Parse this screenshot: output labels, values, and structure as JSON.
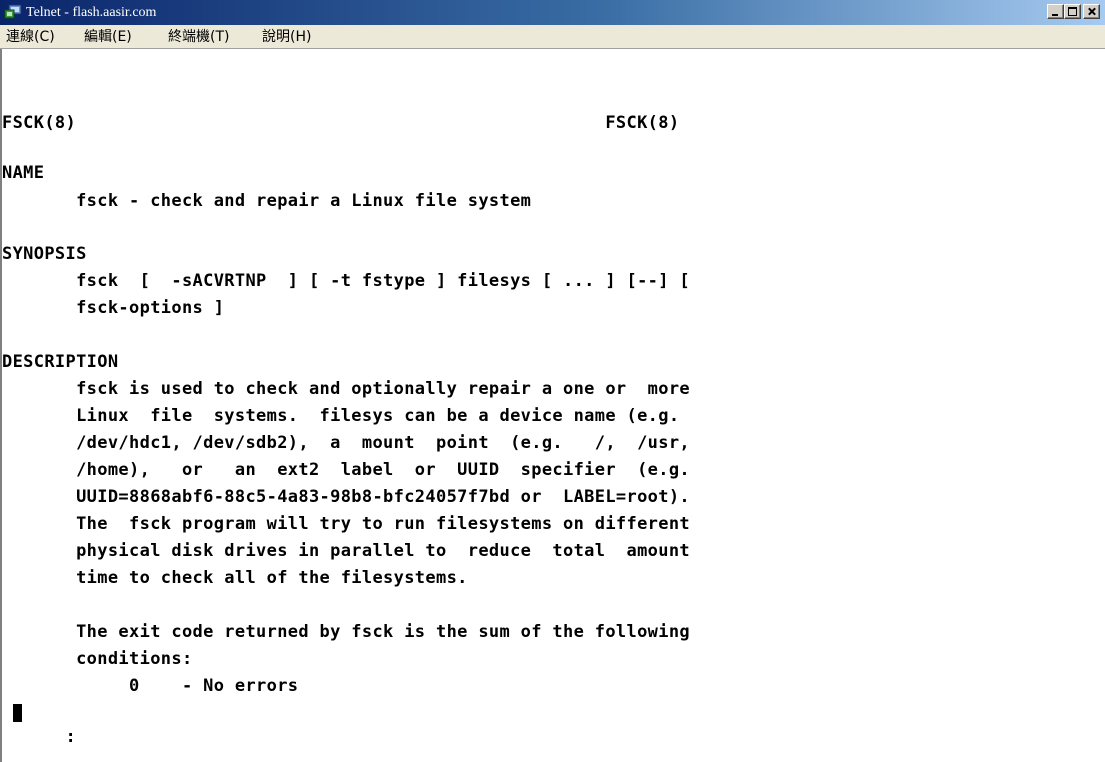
{
  "window": {
    "title": "Telnet - flash.aasir.com",
    "controls": {
      "minimize_icon": "minimize-icon",
      "maximize_icon": "maximize-icon",
      "close_icon": "close-icon"
    }
  },
  "menu": {
    "items": [
      "連線(C)",
      "編輯(E)",
      "終端機(T)",
      "說明(H)"
    ]
  },
  "terminal": {
    "lines": [
      "",
      "FSCK(8)                                                  FSCK(8)",
      "",
      "NAME",
      "       fsck - check and repair a Linux file system",
      "",
      "SYNOPSIS",
      "       fsck  [  -sACVRTNP  ] [ -t fstype ] filesys [ ... ] [--] [",
      "       fsck-options ]",
      "",
      "DESCRIPTION",
      "       fsck is used to check and optionally repair a one or  more",
      "       Linux  file  systems.  filesys can be a device name (e.g.",
      "       /dev/hdc1, /dev/sdb2),  a  mount  point  (e.g.   /,  /usr,",
      "       /home),   or   an  ext2  label  or  UUID  specifier  (e.g.",
      "       UUID=8868abf6-88c5-4a83-98b8-bfc24057f7bd or  LABEL=root).",
      "       The  fsck program will try to run filesystems on different",
      "       physical disk drives in parallel to  reduce  total  amount",
      "       time to check all of the filesystems.",
      "",
      "       The exit code returned by fsck is the sum of the following",
      "       conditions:",
      "            0    - No errors"
    ],
    "prompt": ":"
  }
}
